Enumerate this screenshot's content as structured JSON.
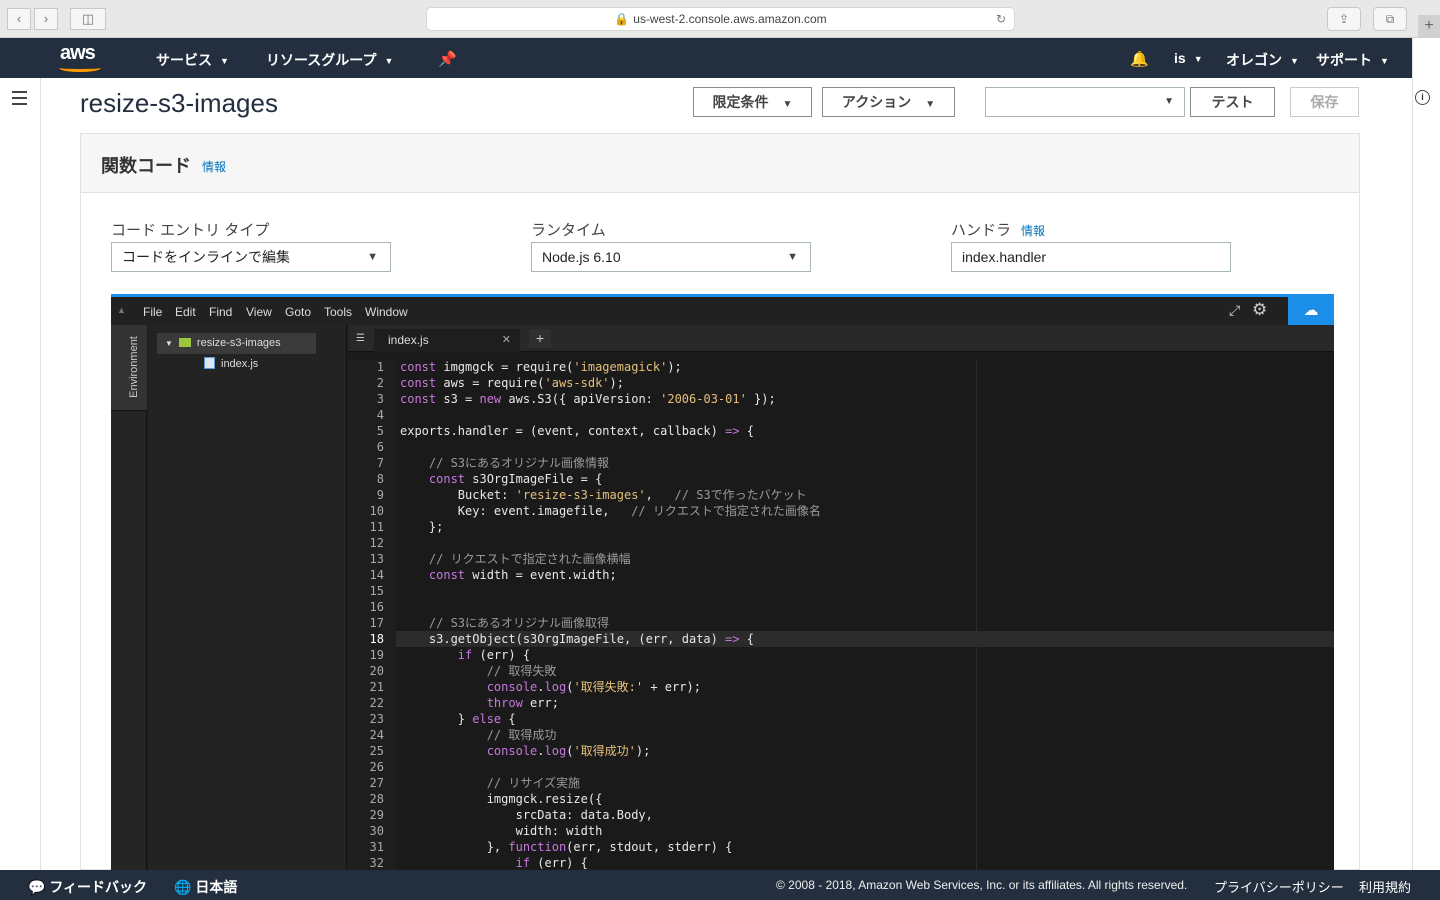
{
  "browser": {
    "url": "us-west-2.console.aws.amazon.com"
  },
  "awsnav": {
    "logo": "aws",
    "services": "サービス",
    "resource_groups": "リソースグループ",
    "user": "is",
    "region": "オレゴン",
    "support": "サポート"
  },
  "header": {
    "title": "resize-s3-images",
    "qualifiers": "限定条件",
    "actions": "アクション",
    "test_event_select": "",
    "test": "テスト",
    "save": "保存"
  },
  "panel": {
    "title": "関数コード",
    "info": "情報",
    "entry_type_label": "コード エントリ タイプ",
    "entry_type_value": "コードをインラインで編集",
    "runtime_label": "ランタイム",
    "runtime_value": "Node.js 6.10",
    "handler_label": "ハンドラ",
    "handler_info": "情報",
    "handler_value": "index.handler"
  },
  "ide": {
    "menu": [
      "File",
      "Edit",
      "Find",
      "View",
      "Goto",
      "Tools",
      "Window"
    ],
    "env_tab": "Environment",
    "tree_folder": "resize-s3-images",
    "tree_file": "index.js",
    "open_tab": "index.js",
    "cursor_line": 18,
    "colors": {
      "keyword": "#c678dd",
      "string": "#e5c07b",
      "comment": "#9a9a9a",
      "accent": "#1b8ee8"
    },
    "code": [
      [
        [
          "k",
          "const"
        ],
        [
          "t",
          " imgmgck = require("
        ],
        [
          "s",
          "'imagemagick'"
        ],
        [
          "t",
          ");"
        ]
      ],
      [
        [
          "k",
          "const"
        ],
        [
          "t",
          " aws = require("
        ],
        [
          "s",
          "'aws-sdk'"
        ],
        [
          "t",
          ");"
        ]
      ],
      [
        [
          "k",
          "const"
        ],
        [
          "t",
          " s3 = "
        ],
        [
          "k",
          "new"
        ],
        [
          "t",
          " aws.S3({ apiVersion: "
        ],
        [
          "s",
          "'2006-03-01'"
        ],
        [
          "t",
          " });"
        ]
      ],
      [],
      [
        [
          "t",
          "exports.handler = (event, context, callback) "
        ],
        [
          "k",
          "=>"
        ],
        [
          "t",
          " {"
        ]
      ],
      [],
      [
        [
          "c",
          "    // S3にあるオリジナル画像情報"
        ]
      ],
      [
        [
          "t",
          "    "
        ],
        [
          "k",
          "const"
        ],
        [
          "t",
          " s3OrgImageFile = {"
        ]
      ],
      [
        [
          "t",
          "        Bucket: "
        ],
        [
          "s",
          "'resize-s3-images'"
        ],
        [
          "t",
          ",   "
        ],
        [
          "c",
          "// S3で作ったバケット"
        ]
      ],
      [
        [
          "t",
          "        Key: event.imagefile,   "
        ],
        [
          "c",
          "// リクエストで指定された画像名"
        ]
      ],
      [
        [
          "t",
          "    };"
        ]
      ],
      [],
      [
        [
          "c",
          "    // リクエストで指定された画像横幅"
        ]
      ],
      [
        [
          "t",
          "    "
        ],
        [
          "k",
          "const"
        ],
        [
          "t",
          " width = event.width;"
        ]
      ],
      [],
      [],
      [
        [
          "c",
          "    // S3にあるオリジナル画像取得"
        ]
      ],
      [
        [
          "t",
          "    s3.getObject(s3OrgImageFile, (err, data) "
        ],
        [
          "k",
          "=>"
        ],
        [
          "t",
          " {"
        ]
      ],
      [
        [
          "t",
          "        "
        ],
        [
          "k",
          "if"
        ],
        [
          "t",
          " (err) {"
        ]
      ],
      [
        [
          "c",
          "            // 取得失敗"
        ]
      ],
      [
        [
          "t",
          "            "
        ],
        [
          "k",
          "console"
        ],
        [
          "t",
          "."
        ],
        [
          "k",
          "log"
        ],
        [
          "t",
          "("
        ],
        [
          "s",
          "'取得失敗:'"
        ],
        [
          "t",
          " + err);"
        ]
      ],
      [
        [
          "t",
          "            "
        ],
        [
          "k",
          "throw"
        ],
        [
          "t",
          " err;"
        ]
      ],
      [
        [
          "t",
          "        } "
        ],
        [
          "k",
          "else"
        ],
        [
          "t",
          " {"
        ]
      ],
      [
        [
          "c",
          "            // 取得成功"
        ]
      ],
      [
        [
          "t",
          "            "
        ],
        [
          "k",
          "console"
        ],
        [
          "t",
          "."
        ],
        [
          "k",
          "log"
        ],
        [
          "t",
          "("
        ],
        [
          "s",
          "'取得成功'"
        ],
        [
          "t",
          ");"
        ]
      ],
      [],
      [
        [
          "c",
          "            // リサイズ実施"
        ]
      ],
      [
        [
          "t",
          "            imgmgck.resize({"
        ]
      ],
      [
        [
          "t",
          "                srcData: data.Body,"
        ]
      ],
      [
        [
          "t",
          "                width: width"
        ]
      ],
      [
        [
          "t",
          "            }, "
        ],
        [
          "k",
          "function"
        ],
        [
          "t",
          "(err, stdout, stderr) {"
        ]
      ],
      [
        [
          "t",
          "                "
        ],
        [
          "k",
          "if"
        ],
        [
          "t",
          " (err) {"
        ]
      ]
    ]
  },
  "footer": {
    "feedback": "フィードバック",
    "language": "日本語",
    "copyright": "© 2008 - 2018, Amazon Web Services, Inc. or its affiliates. All rights reserved.",
    "privacy": "プライバシーポリシー",
    "terms": "利用規約"
  }
}
